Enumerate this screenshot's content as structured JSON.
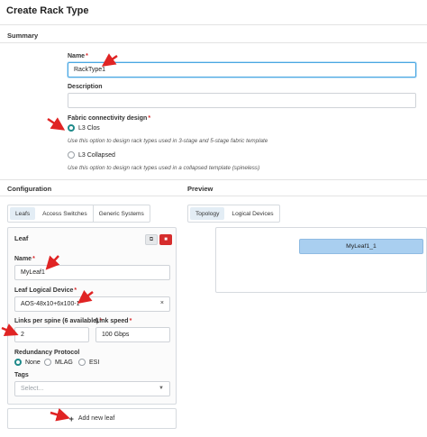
{
  "page": {
    "title": "Create Rack Type"
  },
  "summary": {
    "heading": "Summary",
    "name_label": "Name",
    "name_value": "RackType1",
    "description_label": "Description",
    "description_value": "",
    "fabric_label": "Fabric connectivity design",
    "options": [
      {
        "label": "L3 Clos",
        "hint": "Use this option to design rack types used in 3-stage and 5-stage fabric template",
        "selected": true
      },
      {
        "label": "L3 Collapsed",
        "hint": "Use this option to design rack types used in a collapsed template (spineless)",
        "selected": false
      }
    ],
    "required_mark": "*"
  },
  "configuration": {
    "heading": "Configuration",
    "tabs": [
      "Leafs",
      "Access Switches",
      "Generic Systems"
    ],
    "active_tab": "Leafs",
    "leaf_card": {
      "title": "Leaf",
      "name_label": "Name",
      "name_value": "MyLeaf1",
      "device_label": "Leaf Logical Device",
      "device_value": "AOS-48x10+6x100-1",
      "clear_glyph": "×",
      "links_label": "Links per spine (6 available)",
      "links_value": "2",
      "speed_label": "Link speed",
      "speed_value": "100 Gbps",
      "redundancy_label": "Redundancy Protocol",
      "redundancy_options": [
        "None",
        "MLAG",
        "ESI"
      ],
      "redundancy_selected": "None",
      "tags_label": "Tags",
      "tags_placeholder": "Select...",
      "copy_glyph": "⧉",
      "delete_glyph": "■"
    },
    "add_leaf_label": "Add new leaf",
    "add_leaf_glyph": "+"
  },
  "preview": {
    "heading": "Preview",
    "tabs": [
      "Topology",
      "Logical Devices"
    ],
    "active_tab": "Topology",
    "node_label": "MyLeaf1_1"
  },
  "colors": {
    "accent_teal": "#1f8a8a",
    "annotation_red": "#e02424",
    "node_blue": "#a9cff0",
    "delete_red": "#d62d2d"
  }
}
